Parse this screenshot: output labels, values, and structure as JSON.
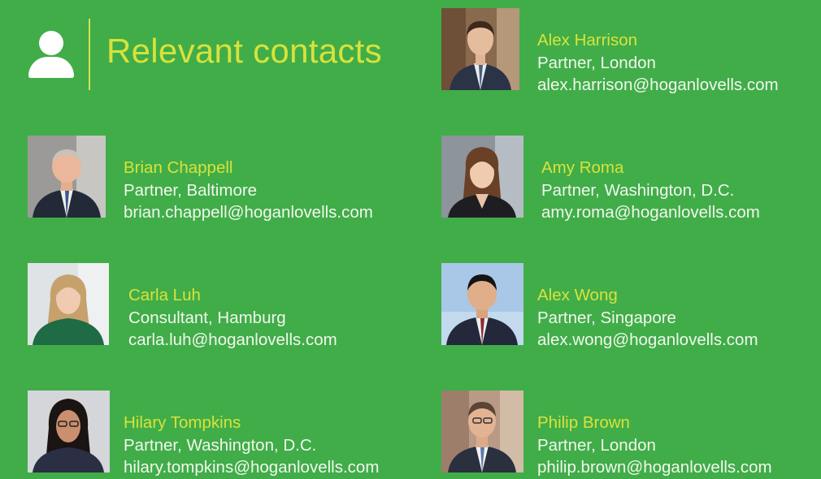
{
  "header": {
    "title": "Relevant contacts",
    "icon": "person-icon"
  },
  "colors": {
    "background": "#40ad49",
    "accent": "#d8e23a",
    "text": "#f2f7ec"
  },
  "contacts": [
    {
      "name": "Alex Harrison",
      "role": "Partner, London",
      "email": "alex.harrison@hoganlovells.com"
    },
    {
      "name": "Brian Chappell",
      "role": "Partner, Baltimore",
      "email": "brian.chappell@hoganlovells.com"
    },
    {
      "name": "Amy Roma",
      "role": "Partner, Washington, D.C.",
      "email": "amy.roma@hoganlovells.com"
    },
    {
      "name": "Carla Luh",
      "role": "Consultant, Hamburg",
      "email": "carla.luh@hoganlovells.com"
    },
    {
      "name": "Alex Wong",
      "role": "Partner, Singapore",
      "email": "alex.wong@hoganlovells.com"
    },
    {
      "name": "Hilary Tompkins",
      "role": "Partner, Washington, D.C.",
      "email": "hilary.tompkins@hoganlovells.com"
    },
    {
      "name": "Philip Brown",
      "role": "Partner, London",
      "email": "philip.brown@hoganlovells.com"
    }
  ]
}
